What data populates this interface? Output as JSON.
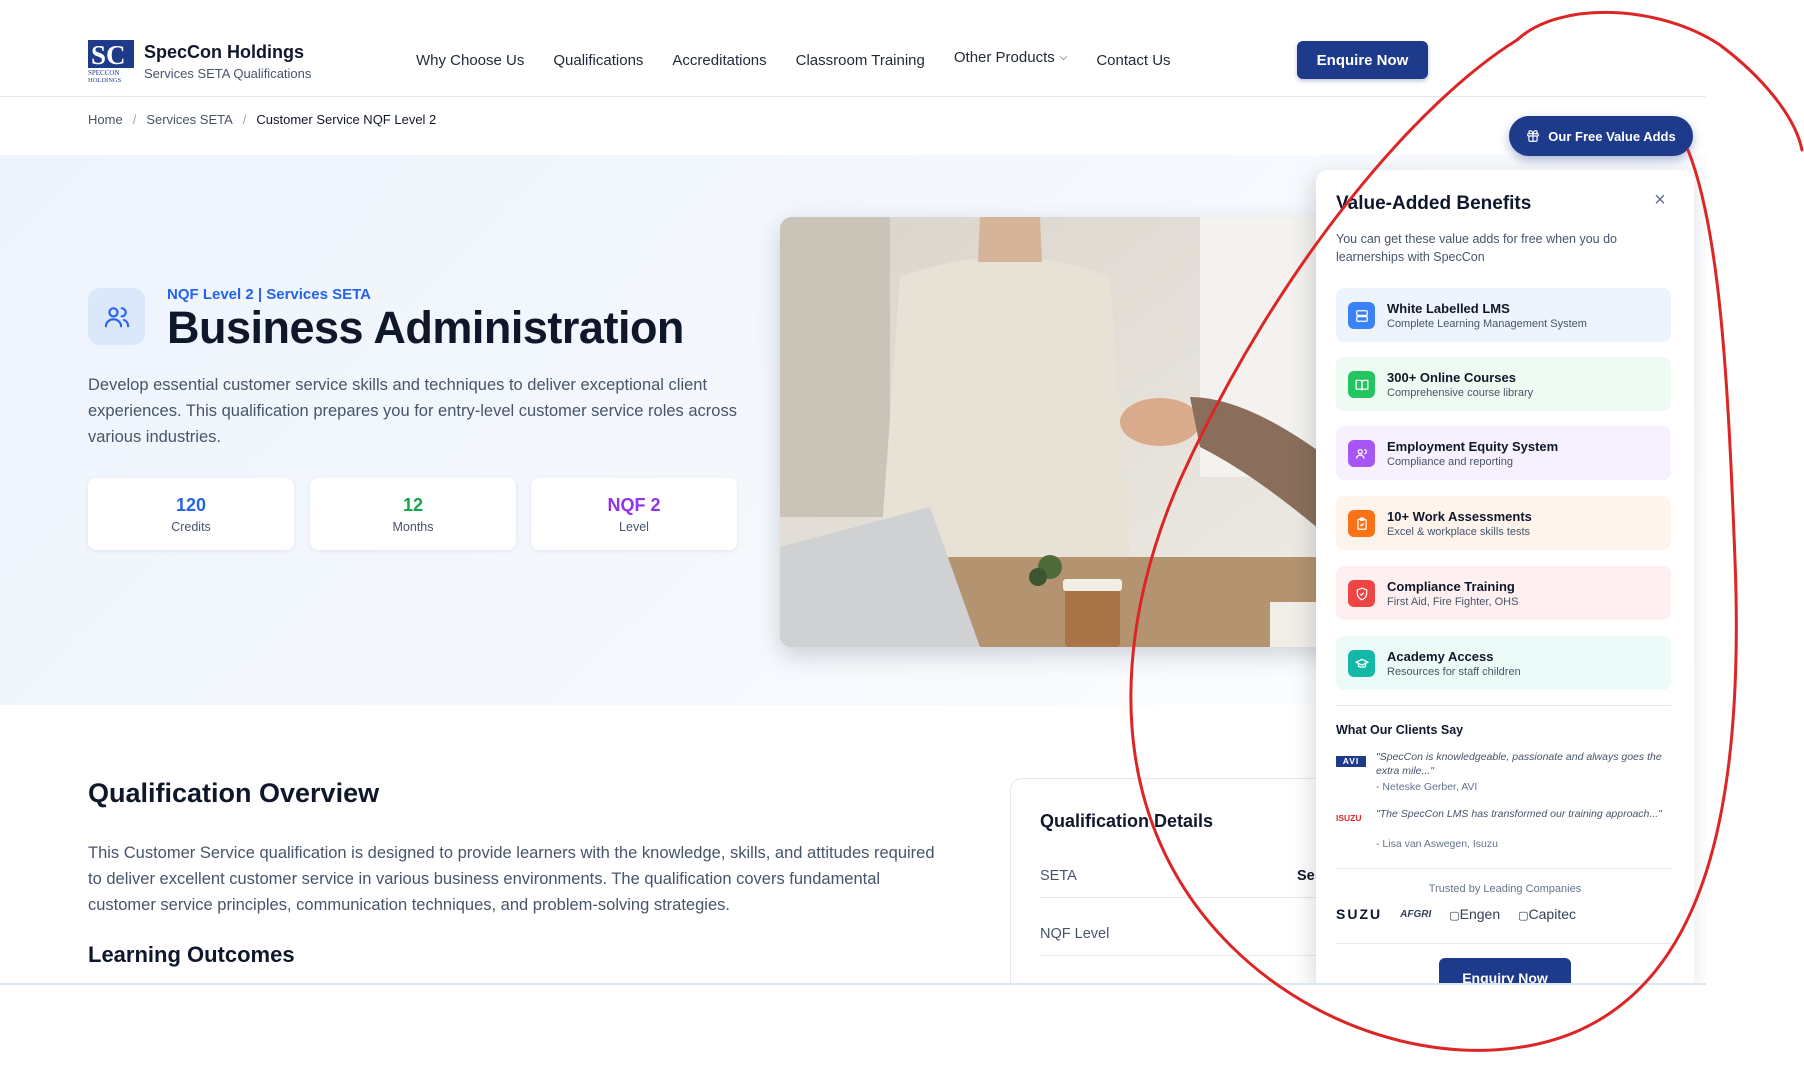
{
  "brand": {
    "name": "SpecCon Holdings",
    "subtitle": "Services SETA Qualifications"
  },
  "nav": {
    "items": [
      "Why Choose Us",
      "Qualifications",
      "Accreditations",
      "Classroom Training",
      "Other Products",
      "Contact Us"
    ],
    "cta": "Enquire Now"
  },
  "breadcrumb": [
    "Home",
    "Services SETA",
    "Customer Service NQF Level 2"
  ],
  "hero": {
    "tag": "NQF Level 2 | Services SETA",
    "title": "Business Administration",
    "description": "Develop essential customer service skills and techniques to deliver exceptional client experiences. This qualification prepares you for entry-level customer service roles across various industries.",
    "stats": [
      {
        "value": "120",
        "label": "Credits",
        "color": "#2563eb"
      },
      {
        "value": "12",
        "label": "Months",
        "color": "#16a34a"
      },
      {
        "value": "NQF 2",
        "label": "Level",
        "color": "#9333ea"
      }
    ]
  },
  "overview": {
    "title": "Qualification Overview",
    "text": "This Customer Service qualification is designed to provide learners with the knowledge, skills, and attitudes required to deliver excellent customer service in various business environments. The qualification covers fundamental customer service principles, communication techniques, and problem-solving strategies.",
    "outcomes_title": "Learning Outcomes"
  },
  "details": {
    "title": "Qualification Details",
    "rows": [
      {
        "key": "SETA",
        "value": "Se"
      },
      {
        "key": "NQF Level",
        "value": ""
      }
    ]
  },
  "value_adds": {
    "pill_label": "Our Free Value Adds",
    "title": "Value-Added Benefits",
    "intro": "You can get these value adds for free when you do learnerships with SpecCon",
    "benefits": [
      {
        "title": "White Labelled LMS",
        "subtitle": "Complete Learning Management System",
        "icon": "server-icon",
        "color": "#3b82f6",
        "bg": "#eef4fe"
      },
      {
        "title": "300+ Online Courses",
        "subtitle": "Comprehensive course library",
        "icon": "book-icon",
        "color": "#22c55e",
        "bg": "#eefbf2"
      },
      {
        "title": "Employment Equity System",
        "subtitle": "Compliance and reporting",
        "icon": "users-icon",
        "color": "#a855f7",
        "bg": "#f7f0fe"
      },
      {
        "title": "10+ Work Assessments",
        "subtitle": "Excel & workplace skills tests",
        "icon": "clipboard-icon",
        "color": "#f97316",
        "bg": "#fef4ec"
      },
      {
        "title": "Compliance Training",
        "subtitle": "First Aid, Fire Fighter, OHS",
        "icon": "shield-icon",
        "color": "#ef4444",
        "bg": "#fef0f0"
      },
      {
        "title": "Academy Access",
        "subtitle": "Resources for staff children",
        "icon": "graduation-cap-icon",
        "color": "#14b8a6",
        "bg": "#edfbf8"
      }
    ],
    "clients_title": "What Our Clients Say",
    "testimonials": [
      {
        "logo": "AVI",
        "quote": "\"SpecCon is knowledgeable, passionate and always goes the extra mile...\"",
        "author": "- Neteske Gerber, AVI"
      },
      {
        "logo": "ISUZU",
        "quote": "\"The SpecCon LMS has transformed our training approach...\"",
        "author": "- Lisa van Aswegen, Isuzu"
      }
    ],
    "trusted_label": "Trusted by Leading Companies",
    "trusted_logos": [
      "SUZU",
      "AFGRI",
      "Engen",
      "Capitec"
    ],
    "enquiry_label": "Enquiry Now"
  }
}
